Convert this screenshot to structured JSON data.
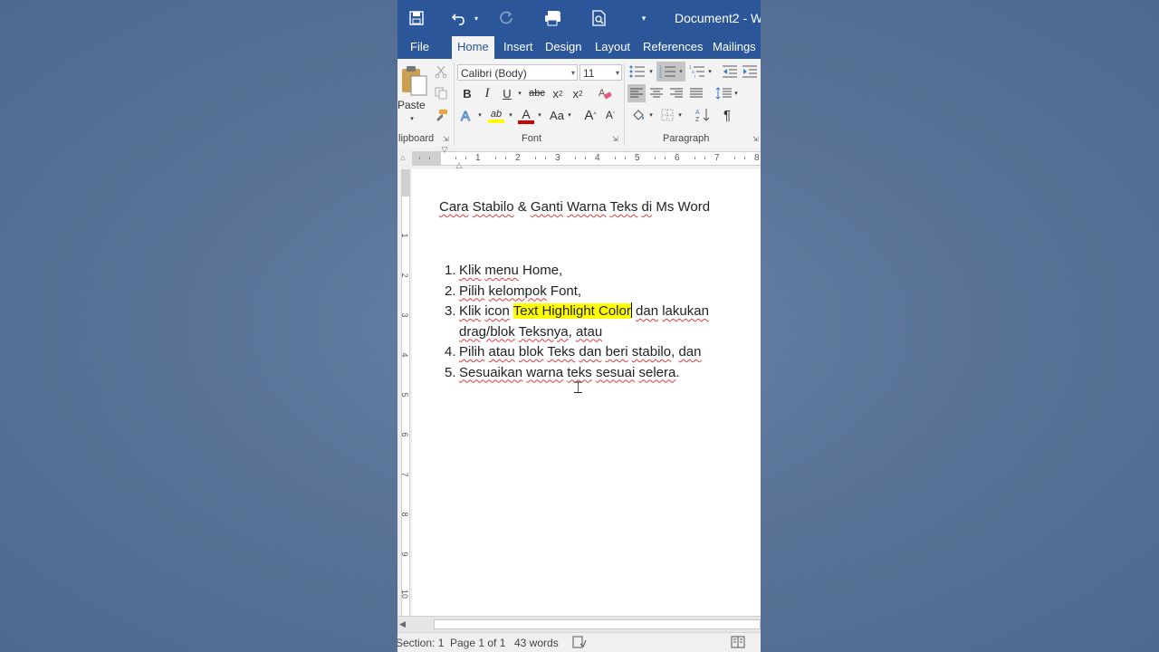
{
  "window": {
    "title": "Document2 - W"
  },
  "quick_access": {
    "save_icon": "save-icon",
    "undo_icon": "undo-icon",
    "redo_icon": "redo-icon",
    "print_icon": "print-icon",
    "preview_icon": "print-preview-icon",
    "customize_icon": "customize-toolbar-icon"
  },
  "tabs": [
    {
      "label": "File"
    },
    {
      "label": "Home"
    },
    {
      "label": "Insert"
    },
    {
      "label": "Design"
    },
    {
      "label": "Layout"
    },
    {
      "label": "References"
    },
    {
      "label": "Mailings"
    }
  ],
  "ribbon": {
    "clipboard": {
      "paste_label": "Paste",
      "group_label": "lipboard"
    },
    "font": {
      "font_name": "Calibri (Body)",
      "font_size": "11",
      "bold": "B",
      "italic": "I",
      "underline": "U",
      "strike": "abc",
      "subscript": "x",
      "superscript": "x",
      "highlight_text": "ab",
      "font_color_letter": "A",
      "change_case": "Aa",
      "grow": "A",
      "shrink": "A",
      "group_label": "Font"
    },
    "paragraph": {
      "pilcrow": "¶",
      "group_label": "Paragraph"
    },
    "colors": {
      "highlight": "#ffff00",
      "font_color": "#d00000",
      "accent": "#2b579a"
    }
  },
  "ruler": {
    "numbers": [
      "1",
      "2",
      "3",
      "4",
      "5",
      "6",
      "7",
      "8"
    ]
  },
  "vertical_ruler": {
    "numbers": [
      "1",
      "2",
      "3",
      "4",
      "5",
      "6",
      "7",
      "8",
      "9",
      "10"
    ]
  },
  "document": {
    "heading": "Cara Stabilo & Ganti Warna Teks di Ms Word",
    "list": [
      {
        "number": "1.",
        "lines": [
          {
            "text": "Klik menu Home,"
          }
        ]
      },
      {
        "number": "2.",
        "lines": [
          {
            "text": "Pilih kelompok Font,"
          }
        ]
      },
      {
        "number": "3.",
        "lines": [
          {
            "before": "Klik icon ",
            "highlight": "Text Highlight Color",
            "after": " dan lakukan"
          },
          {
            "text": "drag/blok Teksnya, atau"
          }
        ]
      },
      {
        "number": "4.",
        "lines": [
          {
            "text": "Pilih atau blok Teks dan beri stabilo, dan"
          }
        ]
      },
      {
        "number": "5.",
        "lines": [
          {
            "text": "Sesuaikan warna teks sesuai selera."
          }
        ]
      }
    ]
  },
  "status": {
    "section": "Section: 1",
    "page": "Page 1 of 1",
    "words": "43 words"
  }
}
